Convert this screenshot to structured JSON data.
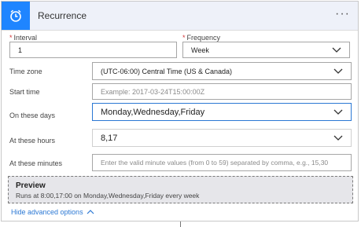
{
  "header": {
    "title": "Recurrence",
    "icon": "alarm-clock-icon",
    "more_label": "···",
    "accent": "#1f85ff"
  },
  "fields": {
    "interval": {
      "label": "Interval",
      "required_mark": "*",
      "value": "1"
    },
    "frequency": {
      "label": "Frequency",
      "required_mark": "*",
      "value": "Week"
    },
    "time_zone": {
      "label": "Time zone",
      "value": "(UTC-06:00) Central Time (US & Canada)"
    },
    "start_time": {
      "label": "Start time",
      "placeholder": "Example: 2017-03-24T15:00:00Z"
    },
    "on_these_days": {
      "label": "On these days",
      "value": "Monday,Wednesday,Friday"
    },
    "at_these_hours": {
      "label": "At these hours",
      "value": "8,17"
    },
    "at_these_minutes": {
      "label": "At these minutes",
      "placeholder": "Enter the valid minute values (from 0 to 59) separated by comma, e.g., 15,30"
    }
  },
  "preview": {
    "title": "Preview",
    "text": "Runs at 8:00,17:00 on Monday,Wednesday,Friday every week"
  },
  "advanced": {
    "label": "Hide advanced options",
    "icon": "chevron-up-icon"
  }
}
